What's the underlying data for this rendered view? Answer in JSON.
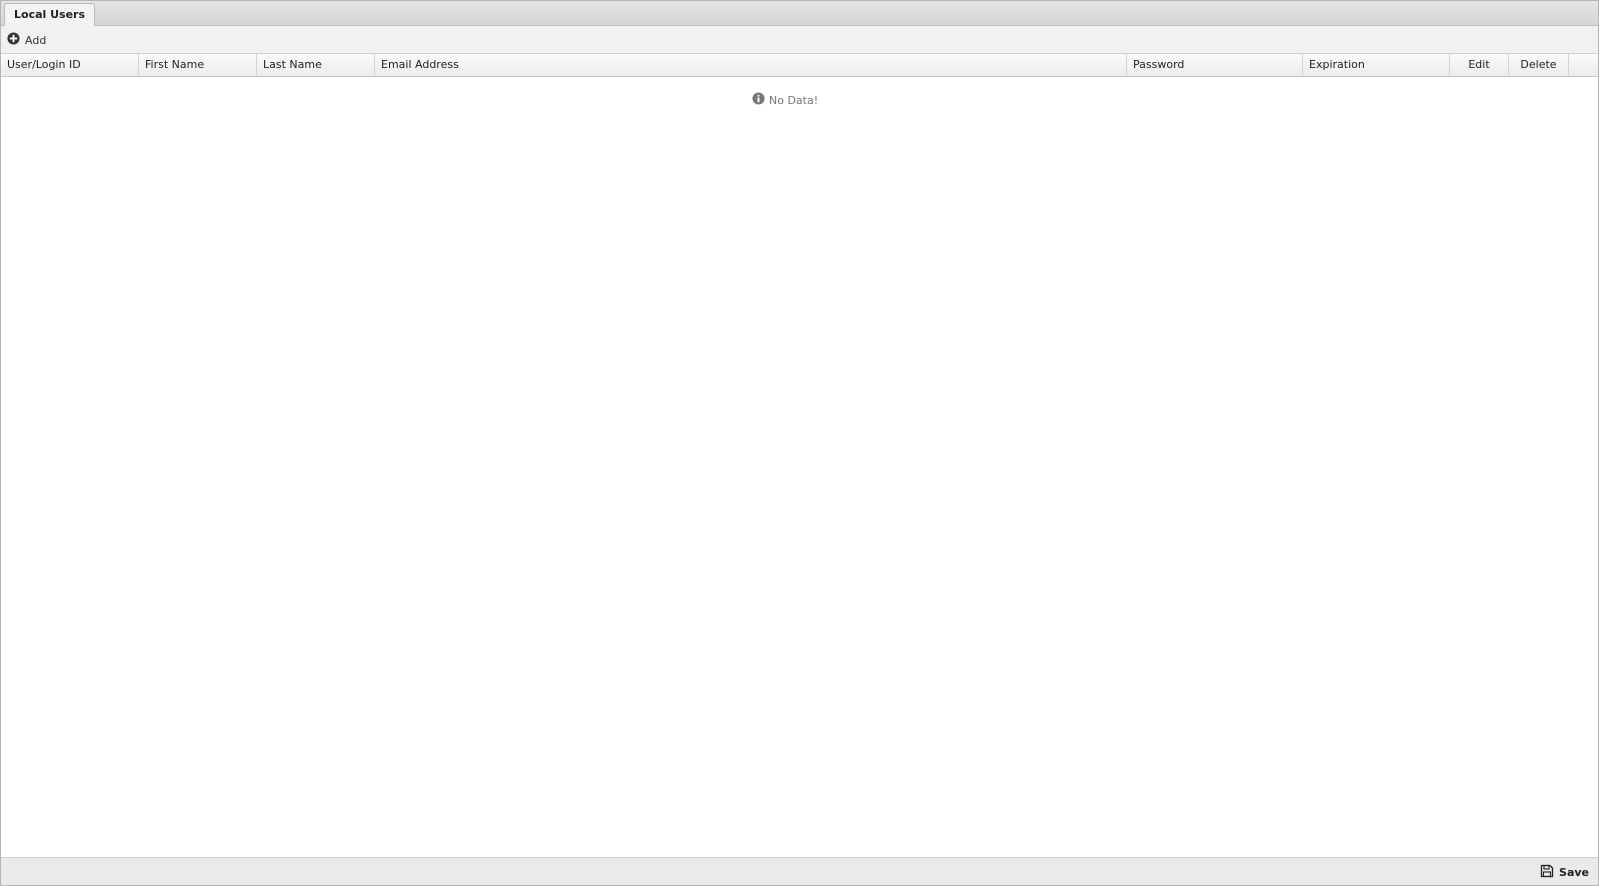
{
  "tabs": [
    {
      "label": "Local Users"
    }
  ],
  "toolbar": {
    "add_label": "Add",
    "add_icon": "plus-circle-icon"
  },
  "grid": {
    "columns": [
      {
        "label": "User/Login ID"
      },
      {
        "label": "First Name"
      },
      {
        "label": "Last Name"
      },
      {
        "label": "Email Address"
      },
      {
        "label": "Password"
      },
      {
        "label": "Expiration"
      },
      {
        "label": "Edit"
      },
      {
        "label": "Delete"
      }
    ],
    "empty_text": "No Data!",
    "empty_icon": "info-icon"
  },
  "footer": {
    "save_label": "Save",
    "save_icon": "floppy-disk-icon"
  }
}
